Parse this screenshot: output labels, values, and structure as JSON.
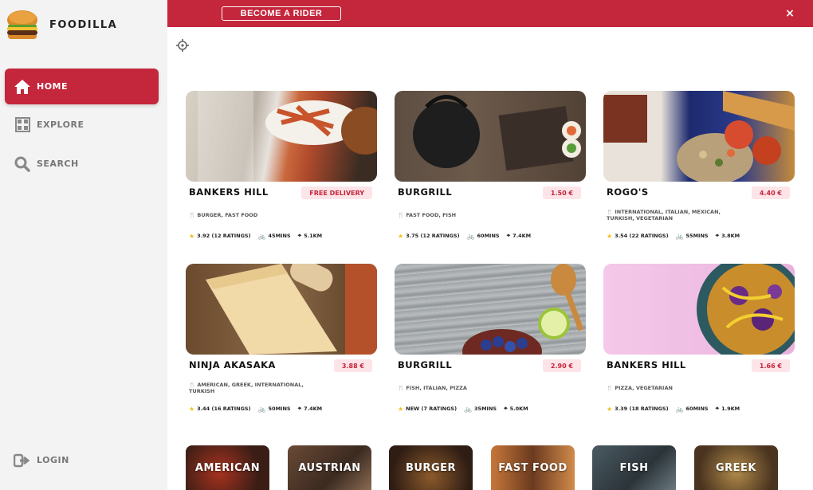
{
  "brand": {
    "name": "FOODILLA",
    "logo_icon": "burger-logo"
  },
  "sidebar": {
    "items": [
      {
        "label": "HOME",
        "icon": "home-icon",
        "active": true
      },
      {
        "label": "EXPLORE",
        "icon": "grid-icon",
        "active": false
      },
      {
        "label": "SEARCH",
        "icon": "search-icon",
        "active": false
      }
    ],
    "login_label": "LOGIN"
  },
  "topbar": {
    "rider_button": "BECOME A RIDER",
    "close_symbol": "×"
  },
  "colors": {
    "accent": "#c4263b",
    "badge_bg": "#fde4e8",
    "star": "#f3c020"
  },
  "restaurants": [
    {
      "name": "BANKERS HILL",
      "badge": "FREE DELIVERY",
      "tags": "BURGER, FAST FOOD",
      "rating": "3.92 (12 RATINGS)",
      "time": "45MINS",
      "distance": "5.1KM"
    },
    {
      "name": "BURGRILL",
      "badge": "1.50 €",
      "tags": "FAST FOOD, FISH",
      "rating": "3.75 (12 RATINGS)",
      "time": "60MINS",
      "distance": "7.4KM"
    },
    {
      "name": "ROGO'S",
      "badge": "4.40 €",
      "tags": "INTERNATIONAL, ITALIAN, MEXICAN, TURKISH, VEGETARIAN",
      "rating": "3.54 (22 RATINGS)",
      "time": "55MINS",
      "distance": "3.8KM"
    },
    {
      "name": "NINJA AKASAKA",
      "badge": "3.88 €",
      "tags": "AMERICAN, GREEK, INTERNATIONAL, TURKISH",
      "rating": "3.44 (16 RATINGS)",
      "time": "50MINS",
      "distance": "7.4KM"
    },
    {
      "name": "BURGRILL",
      "badge": "2.90 €",
      "tags": "FISH, ITALIAN, PIZZA",
      "rating": "NEW (7 RATINGS)",
      "time": "35MINS",
      "distance": "5.0KM"
    },
    {
      "name": "BANKERS HILL",
      "badge": "1.66 €",
      "tags": "PIZZA, VEGETARIAN",
      "rating": "3.39 (18 RATINGS)",
      "time": "60MINS",
      "distance": "1.9KM"
    }
  ],
  "categories": [
    "AMERICAN",
    "AUSTRIAN",
    "BURGER",
    "FAST FOOD",
    "FISH",
    "GREEK"
  ]
}
